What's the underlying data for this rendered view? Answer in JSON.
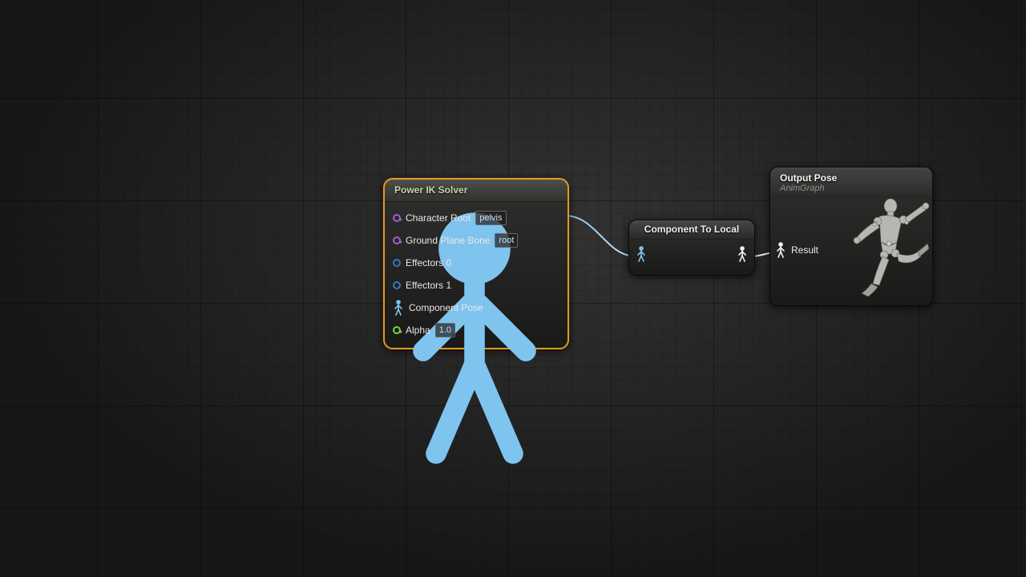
{
  "nodes": {
    "power_ik": {
      "title": "Power IK Solver",
      "pins": {
        "character_root": {
          "label": "Character Root",
          "value": "pelvis"
        },
        "ground_plane_bone": {
          "label": "Ground Plane Bone",
          "value": "root"
        },
        "effectors0": {
          "label": "Effectors 0"
        },
        "effectors1": {
          "label": "Effectors 1"
        },
        "component_pose": {
          "label": "Component Pose"
        },
        "alpha": {
          "label": "Alpha",
          "value": "1.0"
        }
      }
    },
    "component_to_local": {
      "title": "Component To Local"
    },
    "output_pose": {
      "title": "Output Pose",
      "subtitle": "AnimGraph",
      "result_label": "Result"
    }
  },
  "colors": {
    "selection": "#e49a1e",
    "pose_pin_component": "#6fbef3",
    "pose_pin_local": "#f2f2f2"
  }
}
